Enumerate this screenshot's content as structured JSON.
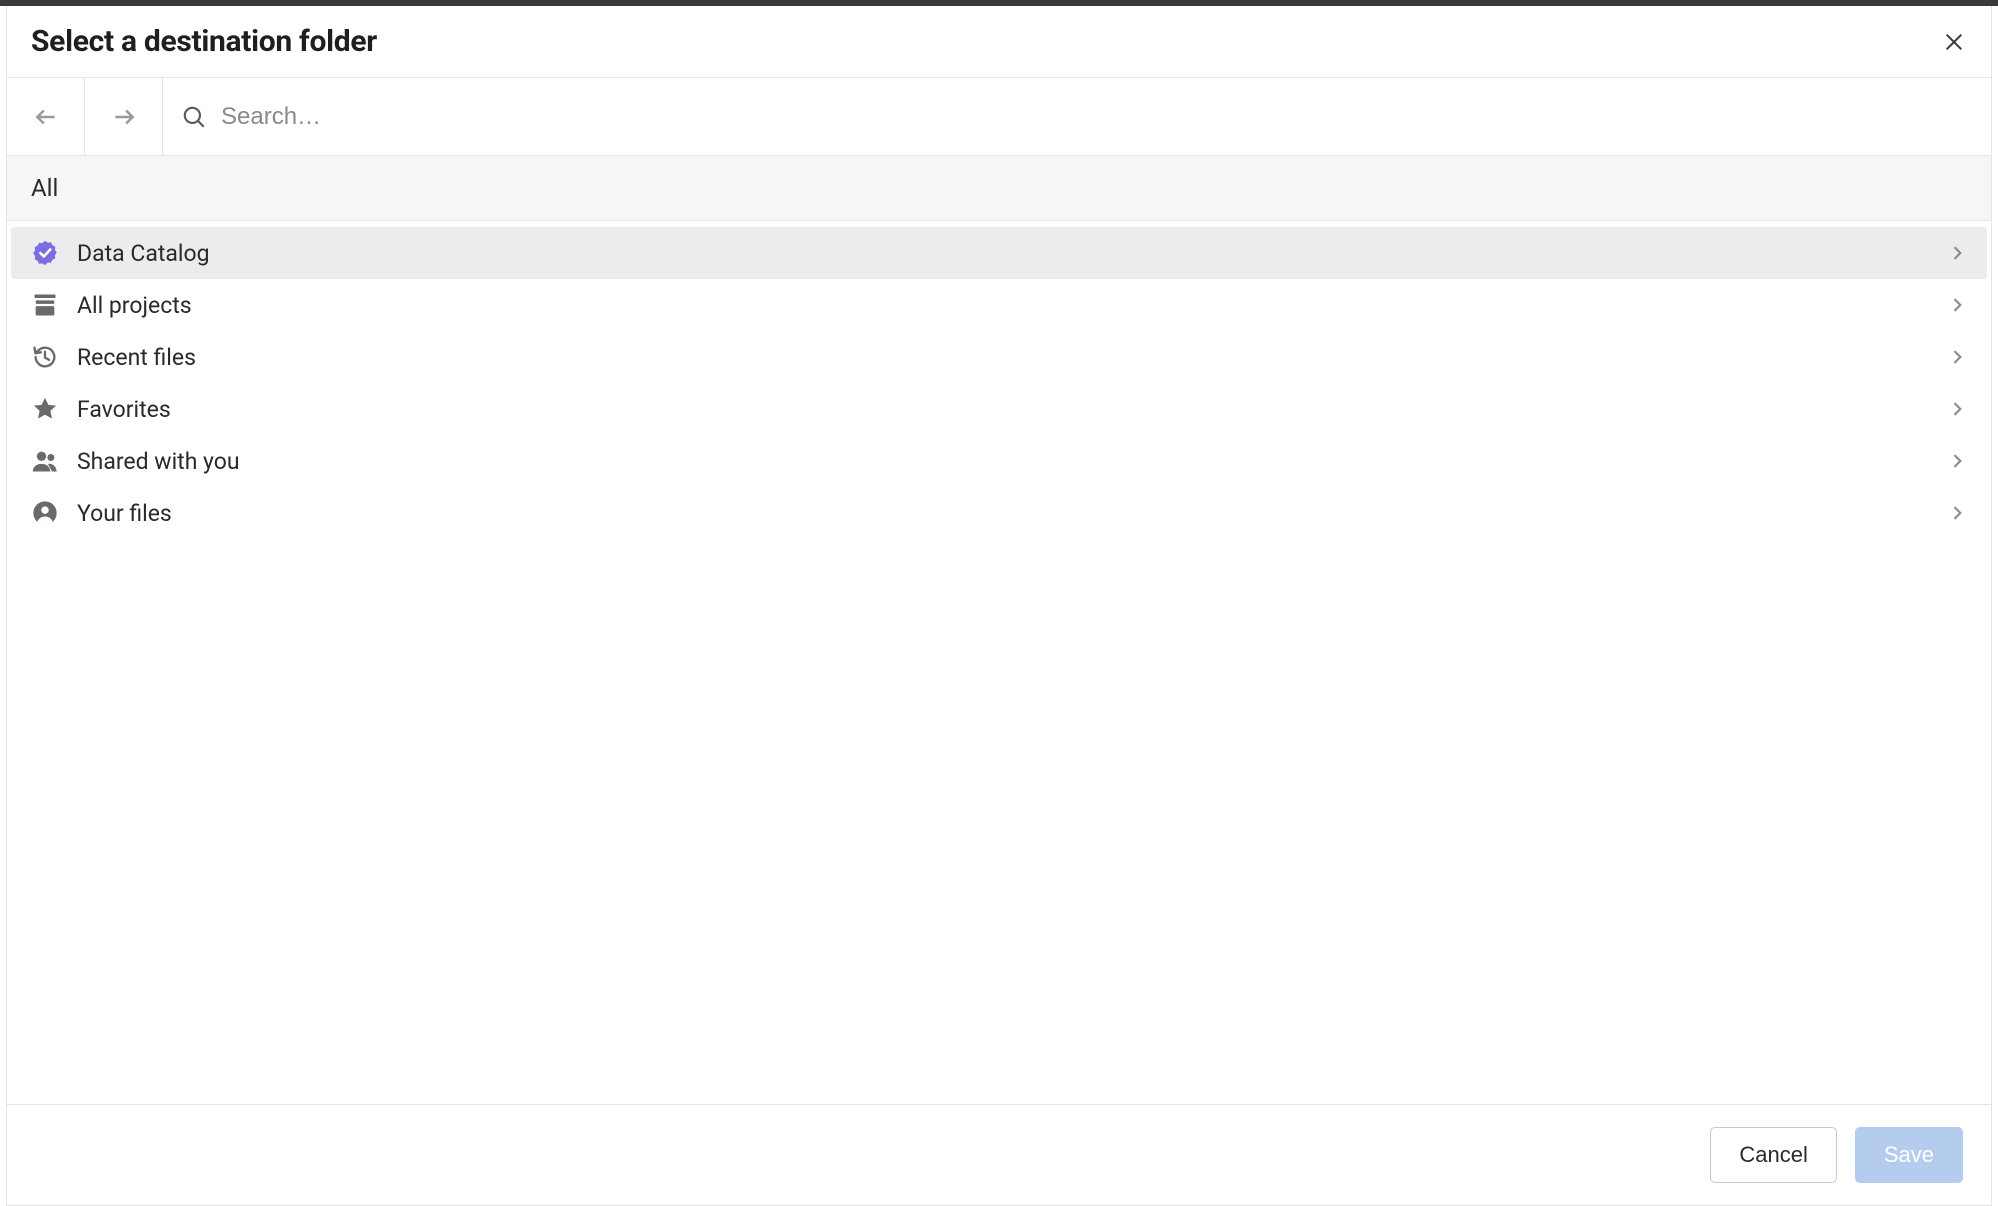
{
  "dialog": {
    "title": "Select a destination folder"
  },
  "search": {
    "placeholder": "Search…",
    "value": ""
  },
  "breadcrumb": {
    "label": "All"
  },
  "folders": [
    {
      "label": "Data Catalog"
    },
    {
      "label": "All projects"
    },
    {
      "label": "Recent files"
    },
    {
      "label": "Favorites"
    },
    {
      "label": "Shared with you"
    },
    {
      "label": "Your files"
    }
  ],
  "footer": {
    "cancel": "Cancel",
    "save": "Save"
  }
}
